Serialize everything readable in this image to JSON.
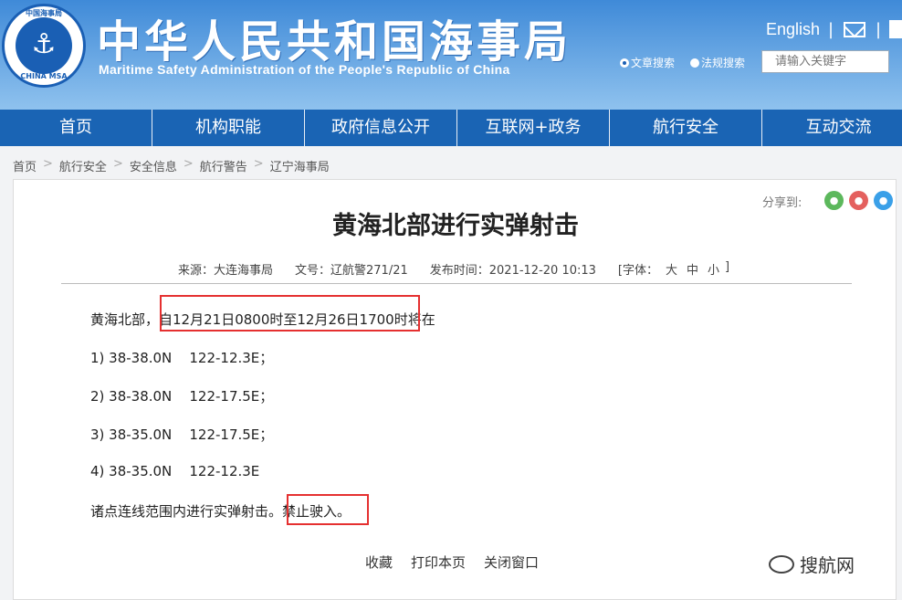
{
  "header": {
    "title_cn": "中华人民共和国海事局",
    "title_en": "Maritime Safety Administration of the People's Republic of China",
    "logo_text_top": "中国海事局",
    "logo_text_bottom": "CHINA MSA",
    "english_link": "English",
    "separator": "|",
    "search_option_article": "文章搜索",
    "search_option_law": "法规搜索",
    "search_placeholder": "请输入关键字",
    "icons": [
      "anchor-icon",
      "mail-icon",
      "document-icon"
    ]
  },
  "nav": {
    "items": [
      "首页",
      "机构职能",
      "政府信息公开",
      "互联网+政务",
      "航行安全",
      "互动交流"
    ]
  },
  "breadcrumb": {
    "items": [
      "首页",
      "航行安全",
      "安全信息",
      "航行警告",
      "辽宁海事局"
    ],
    "separator": ">"
  },
  "article": {
    "share_label": "分享到:",
    "share_icons": [
      "wechat-icon",
      "weibo-icon",
      "qq-icon"
    ],
    "title": "黄海北部进行实弹射击",
    "meta": {
      "source": "来源：大连海事局",
      "doc_no": "文号：辽航警271/21",
      "publish_time": "发布时间：2021-12-20 10:13",
      "font_label": "[字体：",
      "font_large": "大",
      "font_medium": "中",
      "font_small": "小",
      "font_close": "]"
    },
    "para_intro_prefix": "黄海北部，",
    "para_intro_time": "自12月21日0800时至12月26日1700时",
    "para_intro_suffix": "将在",
    "points": [
      "1) 38-38.0N    122-12.3E；",
      "2) 38-38.0N    122-17.5E；",
      "3) 38-35.0N    122-17.5E；",
      "4) 38-35.0N    122-12.3E"
    ],
    "para_end_prefix": "诸点连线范围内进行实弹射击。",
    "para_end_warning": "禁止驶入。",
    "footer_links": [
      "收藏",
      "打印本页",
      "关闭窗口"
    ]
  },
  "watermark": "搜航网",
  "colors": {
    "nav_bg": "#1a64b4",
    "header_top": "#3f8ad8",
    "highlight": "#e53030"
  }
}
